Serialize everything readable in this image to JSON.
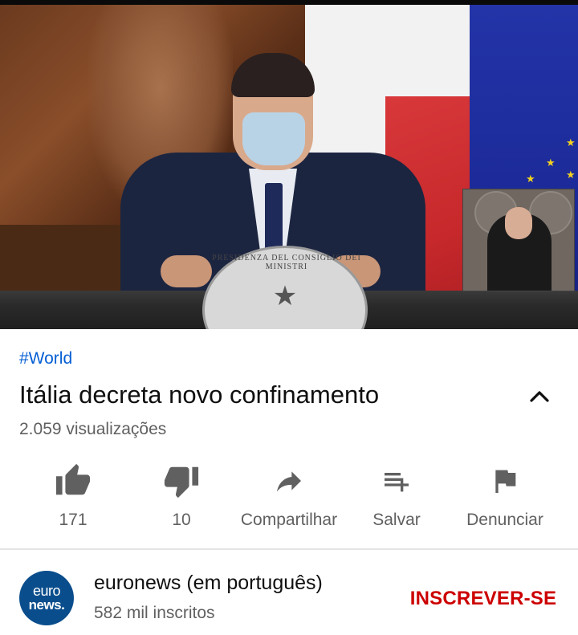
{
  "video": {
    "hashtag": "#World",
    "title": "Itália decreta novo confinamento",
    "views": "2.059 visualizações"
  },
  "actions": {
    "like": {
      "label": "171",
      "icon": "thumbs-up-icon"
    },
    "dislike": {
      "label": "10",
      "icon": "thumbs-down-icon"
    },
    "share": {
      "label": "Compartilhar",
      "icon": "share-arrow-icon"
    },
    "save": {
      "label": "Salvar",
      "icon": "playlist-add-icon"
    },
    "report": {
      "label": "Denunciar",
      "icon": "flag-icon"
    }
  },
  "channel": {
    "avatar_line1": "euro",
    "avatar_line2": "news.",
    "name": "euronews (em português)",
    "subscribers": "582 mil inscritos",
    "subscribe_label": "INSCREVER-SE"
  },
  "player": {
    "seal_text": "PRESIDENZA DEL CONSIGLIO DEI MINISTRI"
  },
  "colors": {
    "link": "#065fd4",
    "subscribe": "#cc0000",
    "secondary_text": "#606060",
    "icon": "#606060"
  }
}
